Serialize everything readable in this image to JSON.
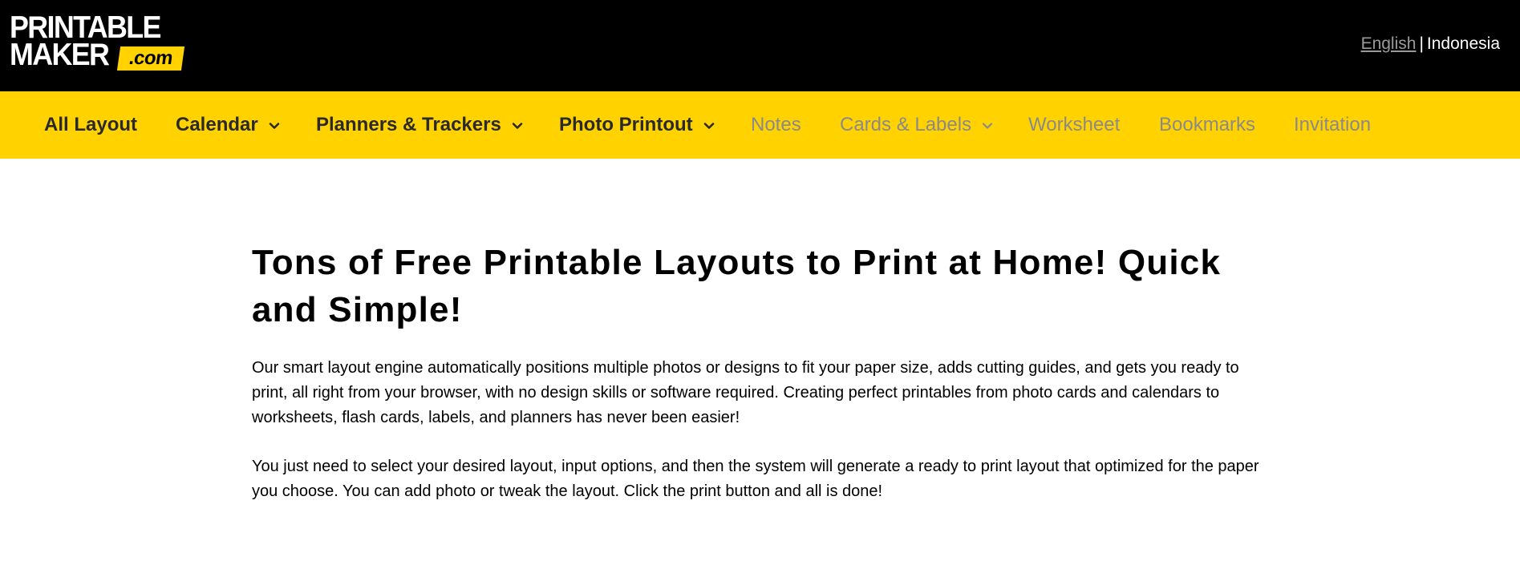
{
  "header": {
    "logo": {
      "line1": "PRINTABLE",
      "line2": "MAKER",
      "suffix": ".com",
      "accent_color": "#ffd200"
    },
    "language": {
      "english": "English",
      "separator": "|",
      "indonesia": "Indonesia"
    }
  },
  "nav": {
    "background_color": "#ffd200",
    "items": [
      {
        "label": "All Layout",
        "dropdown": false,
        "enabled": true
      },
      {
        "label": "Calendar",
        "dropdown": true,
        "enabled": true
      },
      {
        "label": "Planners & Trackers",
        "dropdown": true,
        "enabled": true
      },
      {
        "label": "Photo Printout",
        "dropdown": true,
        "enabled": true
      },
      {
        "label": "Notes",
        "dropdown": false,
        "enabled": false
      },
      {
        "label": "Cards & Labels",
        "dropdown": true,
        "enabled": false
      },
      {
        "label": "Worksheet",
        "dropdown": false,
        "enabled": false
      },
      {
        "label": "Bookmarks",
        "dropdown": false,
        "enabled": false
      },
      {
        "label": "Invitation",
        "dropdown": false,
        "enabled": false
      }
    ],
    "dropdown_icon": "chevron-down-icon"
  },
  "main": {
    "title": "Tons of Free Printable Layouts to Print at Home! Quick and Simple!",
    "paragraph1": "Our smart layout engine automatically positions multiple photos or designs to fit your paper size, adds cutting guides, and gets you ready to print, all right from your browser, with no design skills or software required. Creating perfect printables from photo cards and calendars to worksheets, flash cards, labels, and planners has never been easier!",
    "paragraph2": "You just need to select your desired layout, input options, and then the system will generate a ready to print layout that optimized for the paper you choose. You can add photo or tweak the layout. Click the print button and all is done!"
  }
}
